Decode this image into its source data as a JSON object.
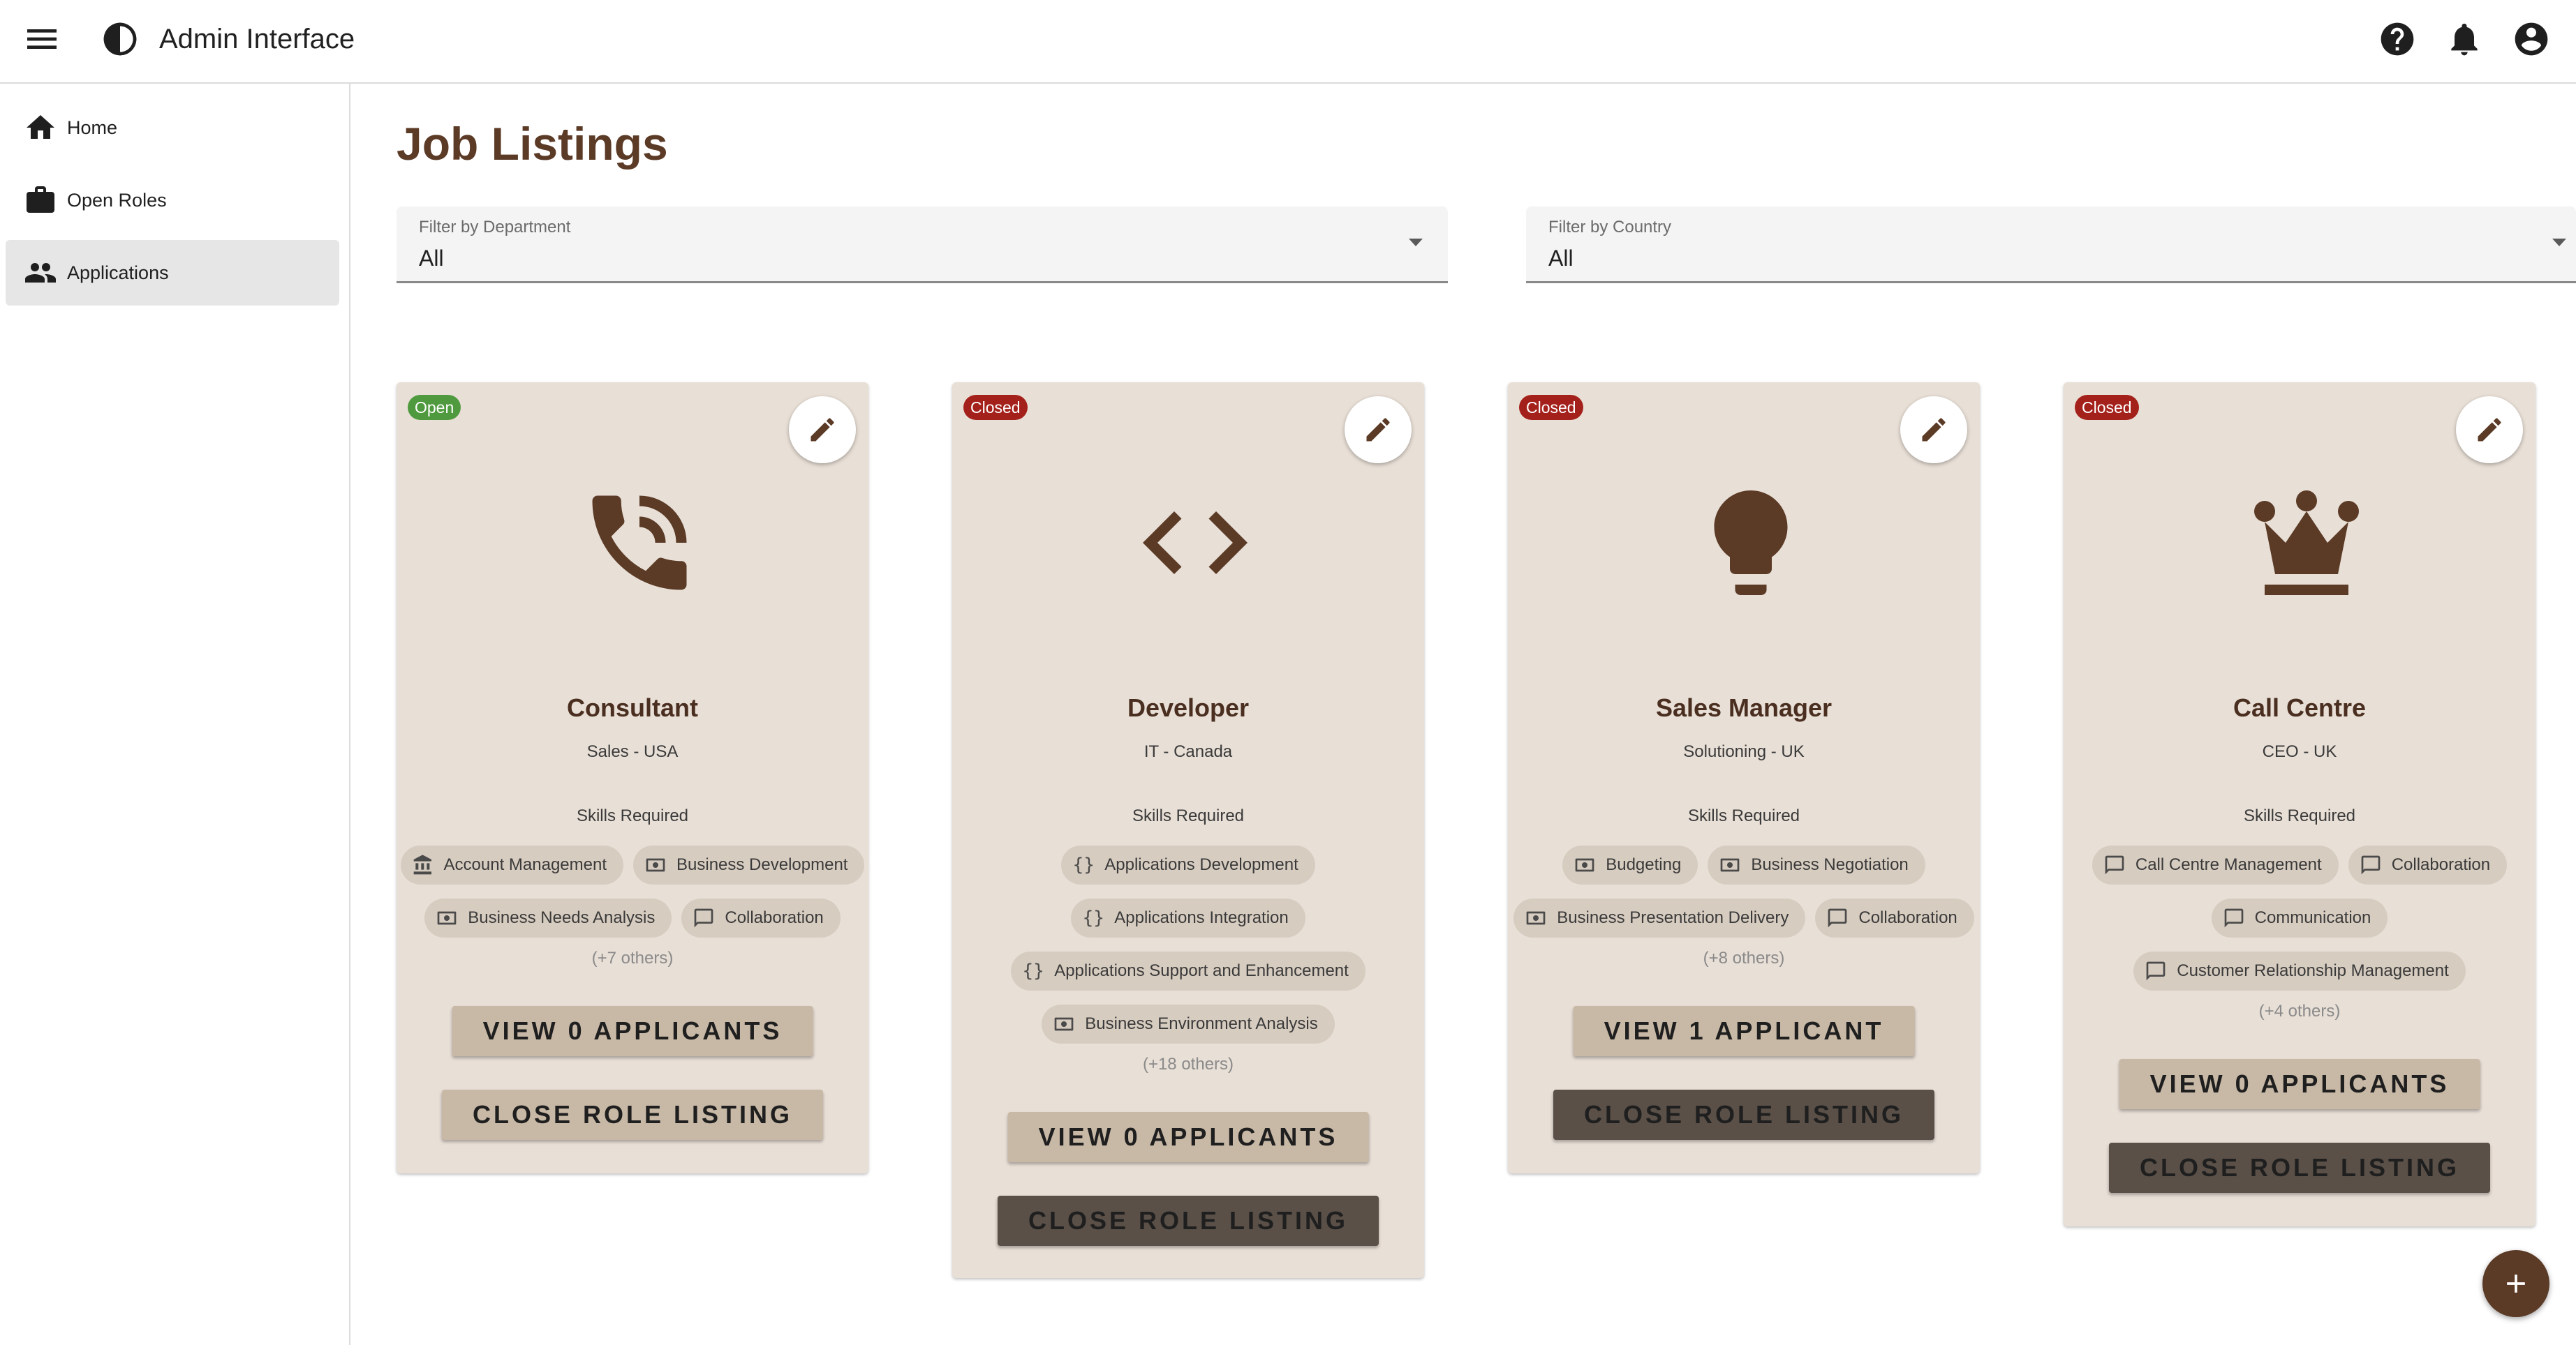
{
  "app": {
    "title": "Admin Interface"
  },
  "sidebar": {
    "items": [
      {
        "label": "Home",
        "icon": "home-icon"
      },
      {
        "label": "Open Roles",
        "icon": "briefcase-icon"
      },
      {
        "label": "Applications",
        "icon": "people-icon",
        "active": true
      }
    ]
  },
  "main": {
    "title": "Job Listings",
    "filters": [
      {
        "label": "Filter by Department",
        "value": "All"
      },
      {
        "label": "Filter by Country",
        "value": "All"
      }
    ]
  },
  "cards": [
    {
      "status": "Open",
      "icon": "phone-icon",
      "title": "Consultant",
      "subtitle": "Sales - USA",
      "skills_heading": "Skills Required",
      "chips": [
        "Account Management",
        "Business Development",
        "Business Needs Analysis",
        "Collaboration"
      ],
      "others": "(+7 others)",
      "view_label": "VIEW 0 APPLICANTS",
      "close_label": "CLOSE ROLE LISTING"
    },
    {
      "status": "Closed",
      "icon": "code-icon",
      "title": "Developer",
      "subtitle": "IT - Canada",
      "skills_heading": "Skills Required",
      "chips": [
        "Applications Development",
        "Applications Integration",
        "Applications Support and Enhancement",
        "Business Environment Analysis"
      ],
      "others": "(+18 others)",
      "view_label": "VIEW 0 APPLICANTS",
      "close_label": "CLOSE ROLE LISTING"
    },
    {
      "status": "Closed",
      "icon": "lightbulb-icon",
      "title": "Sales Manager",
      "subtitle": "Solutioning - UK",
      "skills_heading": "Skills Required",
      "chips": [
        "Budgeting",
        "Business Negotiation",
        "Business Presentation Delivery",
        "Collaboration"
      ],
      "others": "(+8 others)",
      "view_label": "VIEW 1 APPLICANT",
      "close_label": "CLOSE ROLE LISTING"
    },
    {
      "status": "Closed",
      "icon": "crown-icon",
      "title": "Call Centre",
      "subtitle": "CEO - UK",
      "skills_heading": "Skills Required",
      "chips": [
        "Call Centre Management",
        "Collaboration",
        "Communication",
        "Customer Relationship Management"
      ],
      "others": "(+4 others)",
      "view_label": "VIEW 0 APPLICANTS",
      "close_label": "CLOSE ROLE LISTING"
    }
  ],
  "colors": {
    "accent": "#5b3a26",
    "card": "#e8dfd6",
    "open": "#4f9a3e",
    "closed": "#a4211b"
  }
}
